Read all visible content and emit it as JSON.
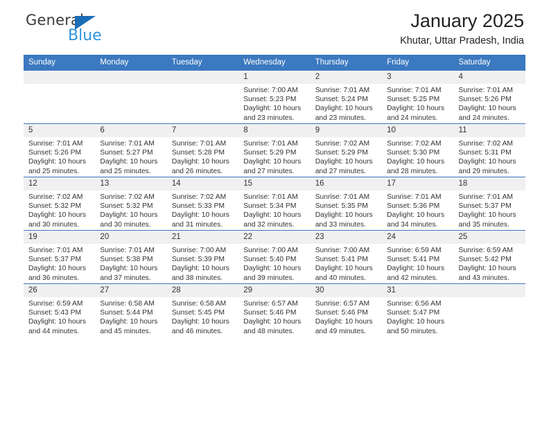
{
  "brand": {
    "name_top": "General",
    "name_bottom": "Blue"
  },
  "header": {
    "title": "January 2025",
    "location": "Khutar, Uttar Pradesh, India"
  },
  "colors": {
    "header_blue": "#3b79c0",
    "daynum_band": "#f0f0f0",
    "brand_blue": "#2e95de",
    "brand_triangle": "#1b6cb5"
  },
  "weekday_headers": [
    "Sunday",
    "Monday",
    "Tuesday",
    "Wednesday",
    "Thursday",
    "Friday",
    "Saturday"
  ],
  "labels": {
    "sunrise_prefix": "Sunrise: ",
    "sunset_prefix": "Sunset: ",
    "daylight_prefix": "Daylight: "
  },
  "weeks": [
    [
      {
        "empty": true
      },
      {
        "empty": true
      },
      {
        "empty": true
      },
      {
        "day": "1",
        "sunrise": "Sunrise: 7:00 AM",
        "sunset": "Sunset: 5:23 PM",
        "daylight1": "Daylight: 10 hours",
        "daylight2": "and 23 minutes."
      },
      {
        "day": "2",
        "sunrise": "Sunrise: 7:01 AM",
        "sunset": "Sunset: 5:24 PM",
        "daylight1": "Daylight: 10 hours",
        "daylight2": "and 23 minutes."
      },
      {
        "day": "3",
        "sunrise": "Sunrise: 7:01 AM",
        "sunset": "Sunset: 5:25 PM",
        "daylight1": "Daylight: 10 hours",
        "daylight2": "and 24 minutes."
      },
      {
        "day": "4",
        "sunrise": "Sunrise: 7:01 AM",
        "sunset": "Sunset: 5:26 PM",
        "daylight1": "Daylight: 10 hours",
        "daylight2": "and 24 minutes."
      }
    ],
    [
      {
        "day": "5",
        "sunrise": "Sunrise: 7:01 AM",
        "sunset": "Sunset: 5:26 PM",
        "daylight1": "Daylight: 10 hours",
        "daylight2": "and 25 minutes."
      },
      {
        "day": "6",
        "sunrise": "Sunrise: 7:01 AM",
        "sunset": "Sunset: 5:27 PM",
        "daylight1": "Daylight: 10 hours",
        "daylight2": "and 25 minutes."
      },
      {
        "day": "7",
        "sunrise": "Sunrise: 7:01 AM",
        "sunset": "Sunset: 5:28 PM",
        "daylight1": "Daylight: 10 hours",
        "daylight2": "and 26 minutes."
      },
      {
        "day": "8",
        "sunrise": "Sunrise: 7:01 AM",
        "sunset": "Sunset: 5:29 PM",
        "daylight1": "Daylight: 10 hours",
        "daylight2": "and 27 minutes."
      },
      {
        "day": "9",
        "sunrise": "Sunrise: 7:02 AM",
        "sunset": "Sunset: 5:29 PM",
        "daylight1": "Daylight: 10 hours",
        "daylight2": "and 27 minutes."
      },
      {
        "day": "10",
        "sunrise": "Sunrise: 7:02 AM",
        "sunset": "Sunset: 5:30 PM",
        "daylight1": "Daylight: 10 hours",
        "daylight2": "and 28 minutes."
      },
      {
        "day": "11",
        "sunrise": "Sunrise: 7:02 AM",
        "sunset": "Sunset: 5:31 PM",
        "daylight1": "Daylight: 10 hours",
        "daylight2": "and 29 minutes."
      }
    ],
    [
      {
        "day": "12",
        "sunrise": "Sunrise: 7:02 AM",
        "sunset": "Sunset: 5:32 PM",
        "daylight1": "Daylight: 10 hours",
        "daylight2": "and 30 minutes."
      },
      {
        "day": "13",
        "sunrise": "Sunrise: 7:02 AM",
        "sunset": "Sunset: 5:32 PM",
        "daylight1": "Daylight: 10 hours",
        "daylight2": "and 30 minutes."
      },
      {
        "day": "14",
        "sunrise": "Sunrise: 7:02 AM",
        "sunset": "Sunset: 5:33 PM",
        "daylight1": "Daylight: 10 hours",
        "daylight2": "and 31 minutes."
      },
      {
        "day": "15",
        "sunrise": "Sunrise: 7:01 AM",
        "sunset": "Sunset: 5:34 PM",
        "daylight1": "Daylight: 10 hours",
        "daylight2": "and 32 minutes."
      },
      {
        "day": "16",
        "sunrise": "Sunrise: 7:01 AM",
        "sunset": "Sunset: 5:35 PM",
        "daylight1": "Daylight: 10 hours",
        "daylight2": "and 33 minutes."
      },
      {
        "day": "17",
        "sunrise": "Sunrise: 7:01 AM",
        "sunset": "Sunset: 5:36 PM",
        "daylight1": "Daylight: 10 hours",
        "daylight2": "and 34 minutes."
      },
      {
        "day": "18",
        "sunrise": "Sunrise: 7:01 AM",
        "sunset": "Sunset: 5:37 PM",
        "daylight1": "Daylight: 10 hours",
        "daylight2": "and 35 minutes."
      }
    ],
    [
      {
        "day": "19",
        "sunrise": "Sunrise: 7:01 AM",
        "sunset": "Sunset: 5:37 PM",
        "daylight1": "Daylight: 10 hours",
        "daylight2": "and 36 minutes."
      },
      {
        "day": "20",
        "sunrise": "Sunrise: 7:01 AM",
        "sunset": "Sunset: 5:38 PM",
        "daylight1": "Daylight: 10 hours",
        "daylight2": "and 37 minutes."
      },
      {
        "day": "21",
        "sunrise": "Sunrise: 7:00 AM",
        "sunset": "Sunset: 5:39 PM",
        "daylight1": "Daylight: 10 hours",
        "daylight2": "and 38 minutes."
      },
      {
        "day": "22",
        "sunrise": "Sunrise: 7:00 AM",
        "sunset": "Sunset: 5:40 PM",
        "daylight1": "Daylight: 10 hours",
        "daylight2": "and 39 minutes."
      },
      {
        "day": "23",
        "sunrise": "Sunrise: 7:00 AM",
        "sunset": "Sunset: 5:41 PM",
        "daylight1": "Daylight: 10 hours",
        "daylight2": "and 40 minutes."
      },
      {
        "day": "24",
        "sunrise": "Sunrise: 6:59 AM",
        "sunset": "Sunset: 5:41 PM",
        "daylight1": "Daylight: 10 hours",
        "daylight2": "and 42 minutes."
      },
      {
        "day": "25",
        "sunrise": "Sunrise: 6:59 AM",
        "sunset": "Sunset: 5:42 PM",
        "daylight1": "Daylight: 10 hours",
        "daylight2": "and 43 minutes."
      }
    ],
    [
      {
        "day": "26",
        "sunrise": "Sunrise: 6:59 AM",
        "sunset": "Sunset: 5:43 PM",
        "daylight1": "Daylight: 10 hours",
        "daylight2": "and 44 minutes."
      },
      {
        "day": "27",
        "sunrise": "Sunrise: 6:58 AM",
        "sunset": "Sunset: 5:44 PM",
        "daylight1": "Daylight: 10 hours",
        "daylight2": "and 45 minutes."
      },
      {
        "day": "28",
        "sunrise": "Sunrise: 6:58 AM",
        "sunset": "Sunset: 5:45 PM",
        "daylight1": "Daylight: 10 hours",
        "daylight2": "and 46 minutes."
      },
      {
        "day": "29",
        "sunrise": "Sunrise: 6:57 AM",
        "sunset": "Sunset: 5:46 PM",
        "daylight1": "Daylight: 10 hours",
        "daylight2": "and 48 minutes."
      },
      {
        "day": "30",
        "sunrise": "Sunrise: 6:57 AM",
        "sunset": "Sunset: 5:46 PM",
        "daylight1": "Daylight: 10 hours",
        "daylight2": "and 49 minutes."
      },
      {
        "day": "31",
        "sunrise": "Sunrise: 6:56 AM",
        "sunset": "Sunset: 5:47 PM",
        "daylight1": "Daylight: 10 hours",
        "daylight2": "and 50 minutes."
      },
      {
        "empty": true
      }
    ]
  ]
}
